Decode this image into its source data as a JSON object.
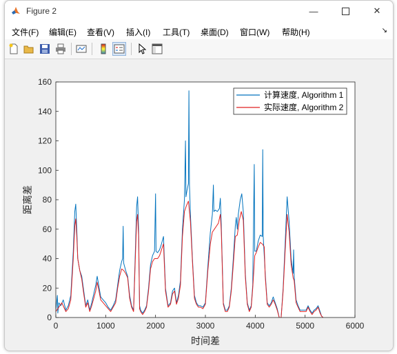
{
  "window": {
    "title": "Figure 2"
  },
  "menu": [
    "文件(F)",
    "编辑(E)",
    "查看(V)",
    "插入(I)",
    "工具(T)",
    "桌面(D)",
    "窗口(W)",
    "帮助(H)"
  ],
  "toolbar": [
    "new-figure-icon",
    "open-folder-icon",
    "save-icon",
    "print-icon",
    "link-plot-icon",
    "colorbar-icon",
    "legend-icon",
    "pointer-icon",
    "property-inspector-icon"
  ],
  "chart_data": {
    "type": "line",
    "title": "",
    "xlabel": "时间差",
    "ylabel": "距离差",
    "xlim": [
      0,
      6000
    ],
    "ylim": [
      0,
      160
    ],
    "xticks": [
      "0",
      "1000",
      "2000",
      "3000",
      "4000",
      "5000",
      "6000"
    ],
    "yticks": [
      "0",
      "20",
      "40",
      "60",
      "80",
      "100",
      "120",
      "140",
      "160"
    ],
    "legend_position": "top-right",
    "series": [
      {
        "name": "计算速度, Algorithm 1",
        "color": "#0072bd",
        "points": [
          [
            0,
            5
          ],
          [
            30,
            15
          ],
          [
            40,
            3
          ],
          [
            60,
            10
          ],
          [
            100,
            8
          ],
          [
            150,
            12
          ],
          [
            200,
            5
          ],
          [
            250,
            8
          ],
          [
            300,
            15
          ],
          [
            350,
            45
          ],
          [
            380,
            72
          ],
          [
            400,
            77
          ],
          [
            420,
            60
          ],
          [
            440,
            40
          ],
          [
            480,
            32
          ],
          [
            520,
            28
          ],
          [
            560,
            18
          ],
          [
            600,
            8
          ],
          [
            640,
            12
          ],
          [
            680,
            5
          ],
          [
            720,
            10
          ],
          [
            760,
            16
          ],
          [
            800,
            22
          ],
          [
            830,
            28
          ],
          [
            860,
            22
          ],
          [
            900,
            14
          ],
          [
            950,
            12
          ],
          [
            1000,
            10
          ],
          [
            1050,
            7
          ],
          [
            1100,
            5
          ],
          [
            1150,
            8
          ],
          [
            1200,
            12
          ],
          [
            1240,
            22
          ],
          [
            1280,
            32
          ],
          [
            1320,
            38
          ],
          [
            1340,
            40
          ],
          [
            1350,
            62
          ],
          [
            1360,
            37
          ],
          [
            1400,
            32
          ],
          [
            1440,
            28
          ],
          [
            1480,
            15
          ],
          [
            1520,
            8
          ],
          [
            1560,
            5
          ],
          [
            1600,
            50
          ],
          [
            1620,
            75
          ],
          [
            1640,
            82
          ],
          [
            1660,
            60
          ],
          [
            1680,
            8
          ],
          [
            1700,
            5
          ],
          [
            1740,
            3
          ],
          [
            1780,
            5
          ],
          [
            1820,
            8
          ],
          [
            1860,
            20
          ],
          [
            1900,
            36
          ],
          [
            1940,
            42
          ],
          [
            1980,
            45
          ],
          [
            2000,
            84
          ],
          [
            2010,
            45
          ],
          [
            2040,
            44
          ],
          [
            2080,
            46
          ],
          [
            2120,
            50
          ],
          [
            2160,
            55
          ],
          [
            2200,
            20
          ],
          [
            2250,
            8
          ],
          [
            2300,
            10
          ],
          [
            2340,
            18
          ],
          [
            2380,
            20
          ],
          [
            2420,
            10
          ],
          [
            2460,
            15
          ],
          [
            2500,
            25
          ],
          [
            2540,
            60
          ],
          [
            2580,
            80
          ],
          [
            2600,
            120
          ],
          [
            2610,
            82
          ],
          [
            2630,
            86
          ],
          [
            2660,
            91
          ],
          [
            2670,
            154
          ],
          [
            2680,
            90
          ],
          [
            2700,
            70
          ],
          [
            2740,
            40
          ],
          [
            2780,
            15
          ],
          [
            2820,
            10
          ],
          [
            2860,
            8
          ],
          [
            2900,
            8
          ],
          [
            2950,
            7
          ],
          [
            3000,
            10
          ],
          [
            3050,
            35
          ],
          [
            3100,
            58
          ],
          [
            3140,
            70
          ],
          [
            3160,
            90
          ],
          [
            3170,
            72
          ],
          [
            3200,
            73
          ],
          [
            3240,
            72
          ],
          [
            3280,
            74
          ],
          [
            3300,
            81
          ],
          [
            3320,
            62
          ],
          [
            3360,
            10
          ],
          [
            3400,
            5
          ],
          [
            3440,
            5
          ],
          [
            3480,
            8
          ],
          [
            3520,
            20
          ],
          [
            3560,
            40
          ],
          [
            3600,
            62
          ],
          [
            3620,
            68
          ],
          [
            3640,
            60
          ],
          [
            3660,
            70
          ],
          [
            3700,
            80
          ],
          [
            3730,
            84
          ],
          [
            3760,
            72
          ],
          [
            3800,
            30
          ],
          [
            3840,
            10
          ],
          [
            3880,
            5
          ],
          [
            3920,
            8
          ],
          [
            3950,
            22
          ],
          [
            3980,
            104
          ],
          [
            3990,
            45
          ],
          [
            4020,
            45
          ],
          [
            4060,
            52
          ],
          [
            4100,
            56
          ],
          [
            4140,
            55
          ],
          [
            4150,
            114
          ],
          [
            4160,
            55
          ],
          [
            4200,
            30
          ],
          [
            4240,
            10
          ],
          [
            4280,
            8
          ],
          [
            4320,
            10
          ],
          [
            4360,
            14
          ],
          [
            4400,
            10
          ],
          [
            4440,
            6
          ],
          [
            4480,
            0
          ],
          [
            4520,
            0
          ],
          [
            4560,
            20
          ],
          [
            4600,
            50
          ],
          [
            4640,
            82
          ],
          [
            4680,
            65
          ],
          [
            4720,
            40
          ],
          [
            4760,
            30
          ],
          [
            4770,
            46
          ],
          [
            4780,
            28
          ],
          [
            4820,
            12
          ],
          [
            4860,
            8
          ],
          [
            4900,
            5
          ],
          [
            4940,
            5
          ],
          [
            4980,
            5
          ],
          [
            5020,
            5
          ],
          [
            5060,
            8
          ],
          [
            5100,
            5
          ],
          [
            5140,
            3
          ],
          [
            5180,
            5
          ],
          [
            5220,
            6
          ],
          [
            5260,
            8
          ],
          [
            5300,
            4
          ],
          [
            5330,
            1
          ],
          [
            5360,
            0
          ]
        ]
      },
      {
        "name": "实际速度, Algorithm 2",
        "color": "#e02020",
        "points": [
          [
            0,
            4
          ],
          [
            40,
            6
          ],
          [
            80,
            8
          ],
          [
            120,
            10
          ],
          [
            160,
            7
          ],
          [
            200,
            4
          ],
          [
            250,
            6
          ],
          [
            300,
            12
          ],
          [
            350,
            40
          ],
          [
            380,
            62
          ],
          [
            400,
            67
          ],
          [
            420,
            55
          ],
          [
            440,
            40
          ],
          [
            480,
            32
          ],
          [
            520,
            26
          ],
          [
            560,
            16
          ],
          [
            600,
            7
          ],
          [
            640,
            10
          ],
          [
            680,
            4
          ],
          [
            720,
            8
          ],
          [
            760,
            13
          ],
          [
            800,
            18
          ],
          [
            830,
            24
          ],
          [
            860,
            19
          ],
          [
            900,
            12
          ],
          [
            950,
            10
          ],
          [
            1000,
            8
          ],
          [
            1050,
            6
          ],
          [
            1100,
            4
          ],
          [
            1150,
            7
          ],
          [
            1200,
            10
          ],
          [
            1240,
            20
          ],
          [
            1280,
            28
          ],
          [
            1320,
            33
          ],
          [
            1360,
            32
          ],
          [
            1400,
            30
          ],
          [
            1440,
            27
          ],
          [
            1480,
            13
          ],
          [
            1520,
            7
          ],
          [
            1560,
            4
          ],
          [
            1600,
            45
          ],
          [
            1620,
            65
          ],
          [
            1640,
            70
          ],
          [
            1660,
            55
          ],
          [
            1680,
            6
          ],
          [
            1700,
            4
          ],
          [
            1740,
            2
          ],
          [
            1780,
            4
          ],
          [
            1820,
            7
          ],
          [
            1860,
            18
          ],
          [
            1900,
            33
          ],
          [
            1940,
            38
          ],
          [
            1980,
            40
          ],
          [
            2040,
            40
          ],
          [
            2080,
            42
          ],
          [
            2120,
            46
          ],
          [
            2160,
            50
          ],
          [
            2200,
            18
          ],
          [
            2250,
            7
          ],
          [
            2300,
            9
          ],
          [
            2340,
            16
          ],
          [
            2380,
            18
          ],
          [
            2420,
            9
          ],
          [
            2460,
            13
          ],
          [
            2500,
            22
          ],
          [
            2540,
            55
          ],
          [
            2580,
            72
          ],
          [
            2620,
            76
          ],
          [
            2660,
            79
          ],
          [
            2700,
            65
          ],
          [
            2740,
            38
          ],
          [
            2780,
            13
          ],
          [
            2820,
            9
          ],
          [
            2860,
            7
          ],
          [
            2900,
            7
          ],
          [
            2950,
            6
          ],
          [
            3000,
            9
          ],
          [
            3050,
            32
          ],
          [
            3100,
            50
          ],
          [
            3140,
            58
          ],
          [
            3180,
            60
          ],
          [
            3220,
            62
          ],
          [
            3260,
            64
          ],
          [
            3300,
            70
          ],
          [
            3320,
            58
          ],
          [
            3360,
            9
          ],
          [
            3400,
            4
          ],
          [
            3440,
            4
          ],
          [
            3480,
            7
          ],
          [
            3520,
            18
          ],
          [
            3560,
            36
          ],
          [
            3600,
            55
          ],
          [
            3640,
            56
          ],
          [
            3680,
            66
          ],
          [
            3720,
            72
          ],
          [
            3760,
            66
          ],
          [
            3800,
            28
          ],
          [
            3840,
            9
          ],
          [
            3880,
            4
          ],
          [
            3920,
            7
          ],
          [
            3950,
            20
          ],
          [
            3990,
            42
          ],
          [
            4020,
            44
          ],
          [
            4060,
            48
          ],
          [
            4100,
            51
          ],
          [
            4140,
            50
          ],
          [
            4180,
            48
          ],
          [
            4200,
            28
          ],
          [
            4240,
            9
          ],
          [
            4280,
            7
          ],
          [
            4320,
            9
          ],
          [
            4360,
            12
          ],
          [
            4400,
            9
          ],
          [
            4440,
            5
          ],
          [
            4480,
            0
          ],
          [
            4520,
            0
          ],
          [
            4560,
            18
          ],
          [
            4600,
            45
          ],
          [
            4640,
            70
          ],
          [
            4680,
            58
          ],
          [
            4720,
            36
          ],
          [
            4760,
            27
          ],
          [
            4780,
            25
          ],
          [
            4820,
            10
          ],
          [
            4860,
            7
          ],
          [
            4900,
            4
          ],
          [
            4940,
            4
          ],
          [
            4980,
            4
          ],
          [
            5020,
            4
          ],
          [
            5060,
            7
          ],
          [
            5100,
            4
          ],
          [
            5140,
            2
          ],
          [
            5180,
            4
          ],
          [
            5220,
            5
          ],
          [
            5260,
            7
          ],
          [
            5300,
            3
          ],
          [
            5330,
            1
          ],
          [
            5360,
            0
          ]
        ]
      }
    ]
  }
}
